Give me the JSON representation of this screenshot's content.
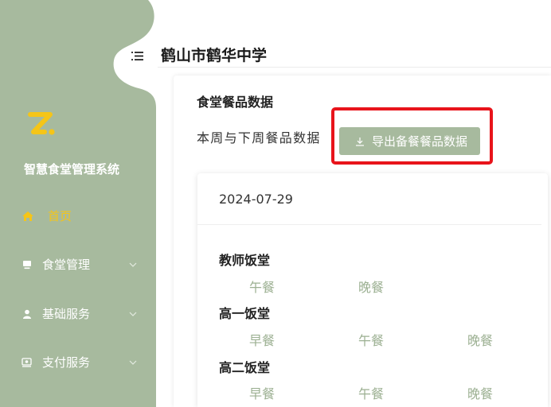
{
  "app": {
    "title": "智慧食堂管理系统"
  },
  "header": {
    "school_name": "鹤山市鹤华中学",
    "menu_icon": "menu-icon"
  },
  "sidebar": {
    "items": [
      {
        "label": "首页",
        "icon": "home-icon",
        "active": true
      },
      {
        "label": "食堂管理",
        "icon": "monitor-icon",
        "active": false
      },
      {
        "label": "基础服务",
        "icon": "user-icon",
        "active": false
      },
      {
        "label": "支付服务",
        "icon": "wallet-icon",
        "active": false
      }
    ]
  },
  "main": {
    "section_title": "食堂餐品数据",
    "subtitle": "本周与下周餐品数据",
    "export_button": {
      "label": "导出备餐餐品数据",
      "icon": "download-icon"
    },
    "date": "2024-07-29",
    "canteens": [
      {
        "name": "教师饭堂",
        "meals": [
          "午餐",
          "晚餐"
        ]
      },
      {
        "name": "高一饭堂",
        "meals": [
          "早餐",
          "午餐",
          "晚餐"
        ]
      },
      {
        "name": "高二饭堂",
        "meals": [
          "早餐",
          "午餐",
          "晚餐"
        ]
      }
    ]
  },
  "colors": {
    "accent": "#a7ba9e",
    "active": "#f5c518",
    "highlight": "#e8141b",
    "meal": "#9cb092"
  }
}
